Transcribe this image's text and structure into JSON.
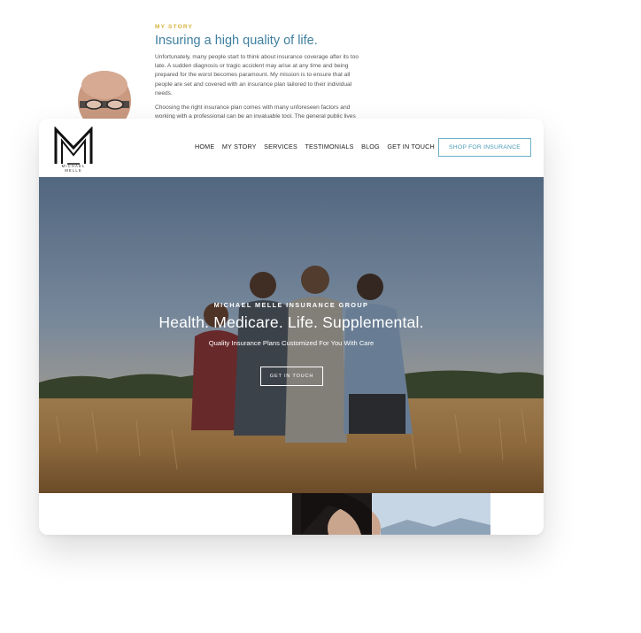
{
  "story": {
    "label": "MY STORY",
    "title": "Insuring a high quality of life.",
    "para1": "Unfortunately, many people start to think about insurance coverage after its too late. A sudden diagnosis or tragic accident may arise at any time and being prepared for the worst becomes paramount. My mission is to ensure that all people are set and covered with an insurance plan tailored to their individual needs.",
    "para2": "Choosing the right insurance plan comes with many unforeseen factors and working with a professional can be an invaluable tool. The general public lives"
  },
  "header": {
    "logo_text": "MICHAEL MELLE",
    "nav": [
      "HOME",
      "MY STORY",
      "SERVICES",
      "TESTIMONIALS",
      "BLOG",
      "GET IN TOUCH"
    ],
    "cta": "SHOP FOR INSURANCE"
  },
  "hero": {
    "eyebrow": "MICHAEL MELLE INSURANCE GROUP",
    "title": "Health. Medicare. Life. Supplemental.",
    "subtitle": "Quality Insurance Plans Customized For You With Care",
    "button": "GET IN TOUCH"
  },
  "colors": {
    "accent": "#4b9bb8",
    "gold": "#d8b23c",
    "story_title": "#3f7fa0"
  }
}
